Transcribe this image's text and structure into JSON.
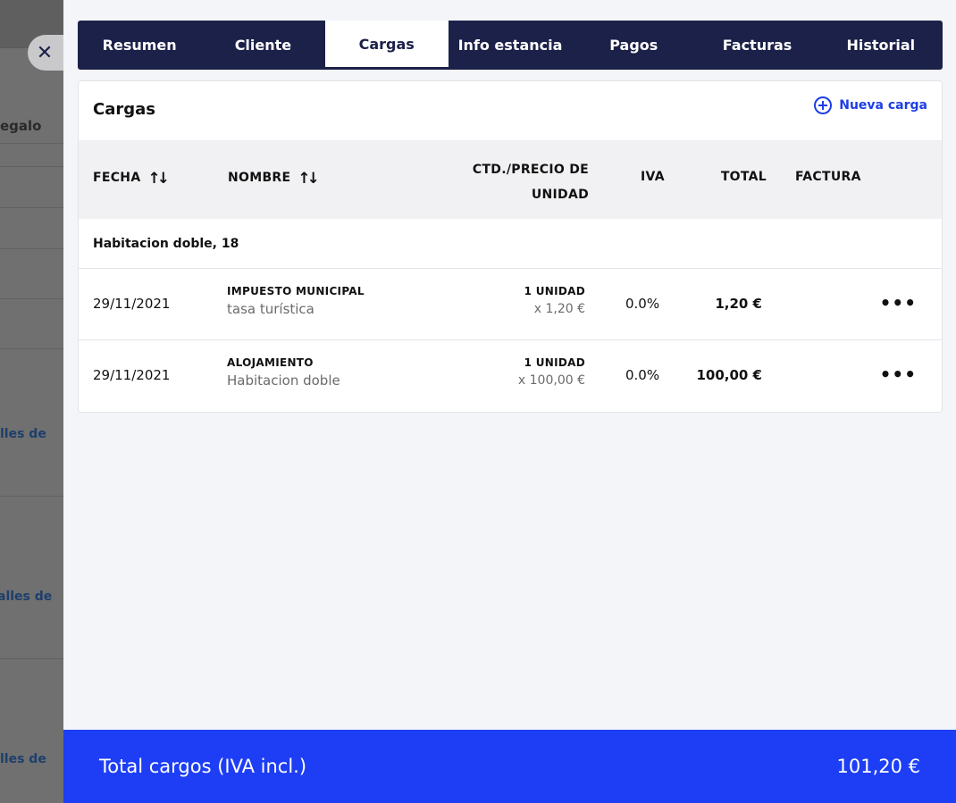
{
  "background": {
    "text_regalo": "egalo",
    "links": [
      "lles de",
      "alles de",
      "lles de"
    ]
  },
  "tabs": [
    {
      "label": "Resumen",
      "active": false
    },
    {
      "label": "Cliente",
      "active": false
    },
    {
      "label": "Cargas",
      "active": true
    },
    {
      "label": "Info estancia",
      "active": false
    },
    {
      "label": "Pagos",
      "active": false
    },
    {
      "label": "Facturas",
      "active": false
    },
    {
      "label": "Historial",
      "active": false
    }
  ],
  "card": {
    "title": "Cargas",
    "new_charge_label": "Nueva carga",
    "columns": {
      "fecha": "FECHA",
      "nombre": "NOMBRE",
      "ctd_line1": "CTD./PRECIO DE",
      "ctd_line2": "UNIDAD",
      "iva": "IVA",
      "total": "TOTAL",
      "factura": "FACTURA"
    },
    "group_label": "Habitacion doble, 18",
    "rows": [
      {
        "fecha": "29/11/2021",
        "name": "IMPUESTO MUNICIPAL",
        "description": "tasa turística",
        "qty": "1 UNIDAD",
        "unit_price": "x 1,20 €",
        "iva": "0.0%",
        "total": "1,20 €"
      },
      {
        "fecha": "29/11/2021",
        "name": "ALOJAMIENTO",
        "description": "Habitacion doble",
        "qty": "1 UNIDAD",
        "unit_price": "x 100,00 €",
        "iva": "0.0%",
        "total": "100,00 €"
      }
    ]
  },
  "footer": {
    "label": "Total cargos (IVA incl.)",
    "amount": "101,20 €"
  },
  "colors": {
    "navy": "#1b2148",
    "accent_blue": "#1d3ef5",
    "link_blue": "#1d3ee6"
  }
}
